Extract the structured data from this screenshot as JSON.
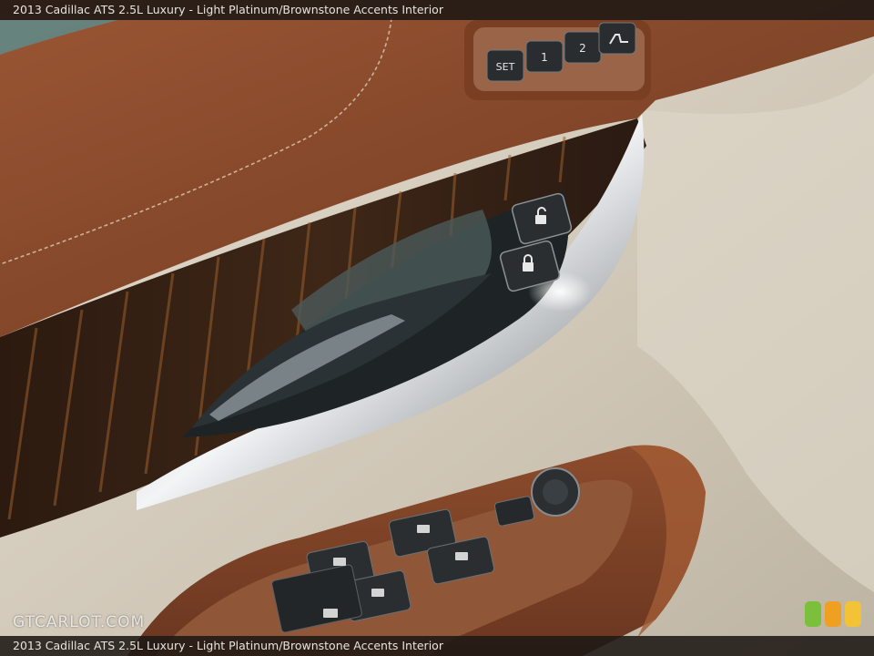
{
  "caption": {
    "top": "2013 Cadillac ATS 2.5L Luxury - Light Platinum/Brownstone Accents Interior",
    "bottom": "2013 Cadillac ATS 2.5L Luxury - Light Platinum/Brownstone Accents Interior"
  },
  "watermark": "GTCARLOT.COM",
  "memory_buttons": {
    "set": "SET",
    "one": "1",
    "two": "2"
  },
  "colors": {
    "leather": "#8a4a2a",
    "cream": "#d6cebf",
    "wood": "#3a2418",
    "chrome": "#c8ccd0"
  }
}
